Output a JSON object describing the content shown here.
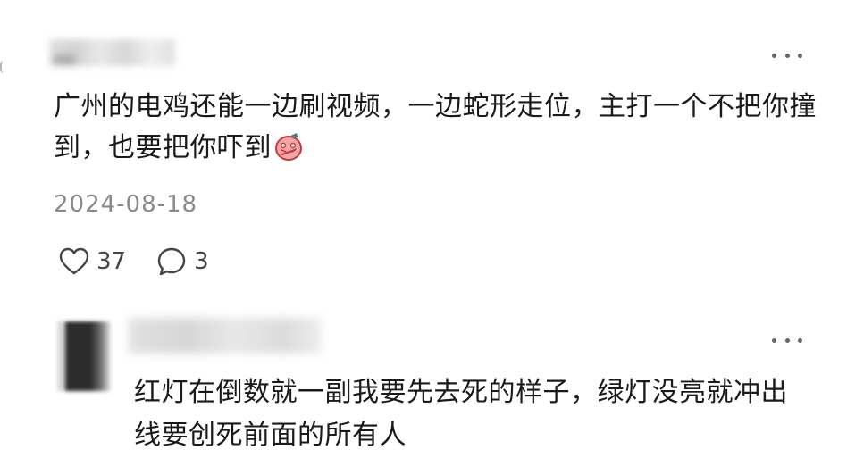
{
  "comments": [
    {
      "text": "广州的电鸡还能一边刷视频，一边蛇形走位，主打一个不把你撞到，也要把你吓到",
      "emoji": "scared-face-emoji",
      "date": "2024-08-18",
      "likes": "37",
      "replies": "3",
      "icons": {
        "like": "heart-outline-icon",
        "reply": "speech-bubble-icon",
        "more": "more-dots-icon"
      }
    },
    {
      "text": "红灯在倒数就一副我要先去死的样子，绿灯没亮就冲出线要创死前面的所有人",
      "icons": {
        "more": "more-dots-icon"
      }
    }
  ],
  "colors": {
    "text": "#1a1a1a",
    "meta": "#8a8a8a",
    "icon": "#444444",
    "emoji_fill": "#f4a6a6",
    "emoji_outline": "#c23b3b"
  }
}
